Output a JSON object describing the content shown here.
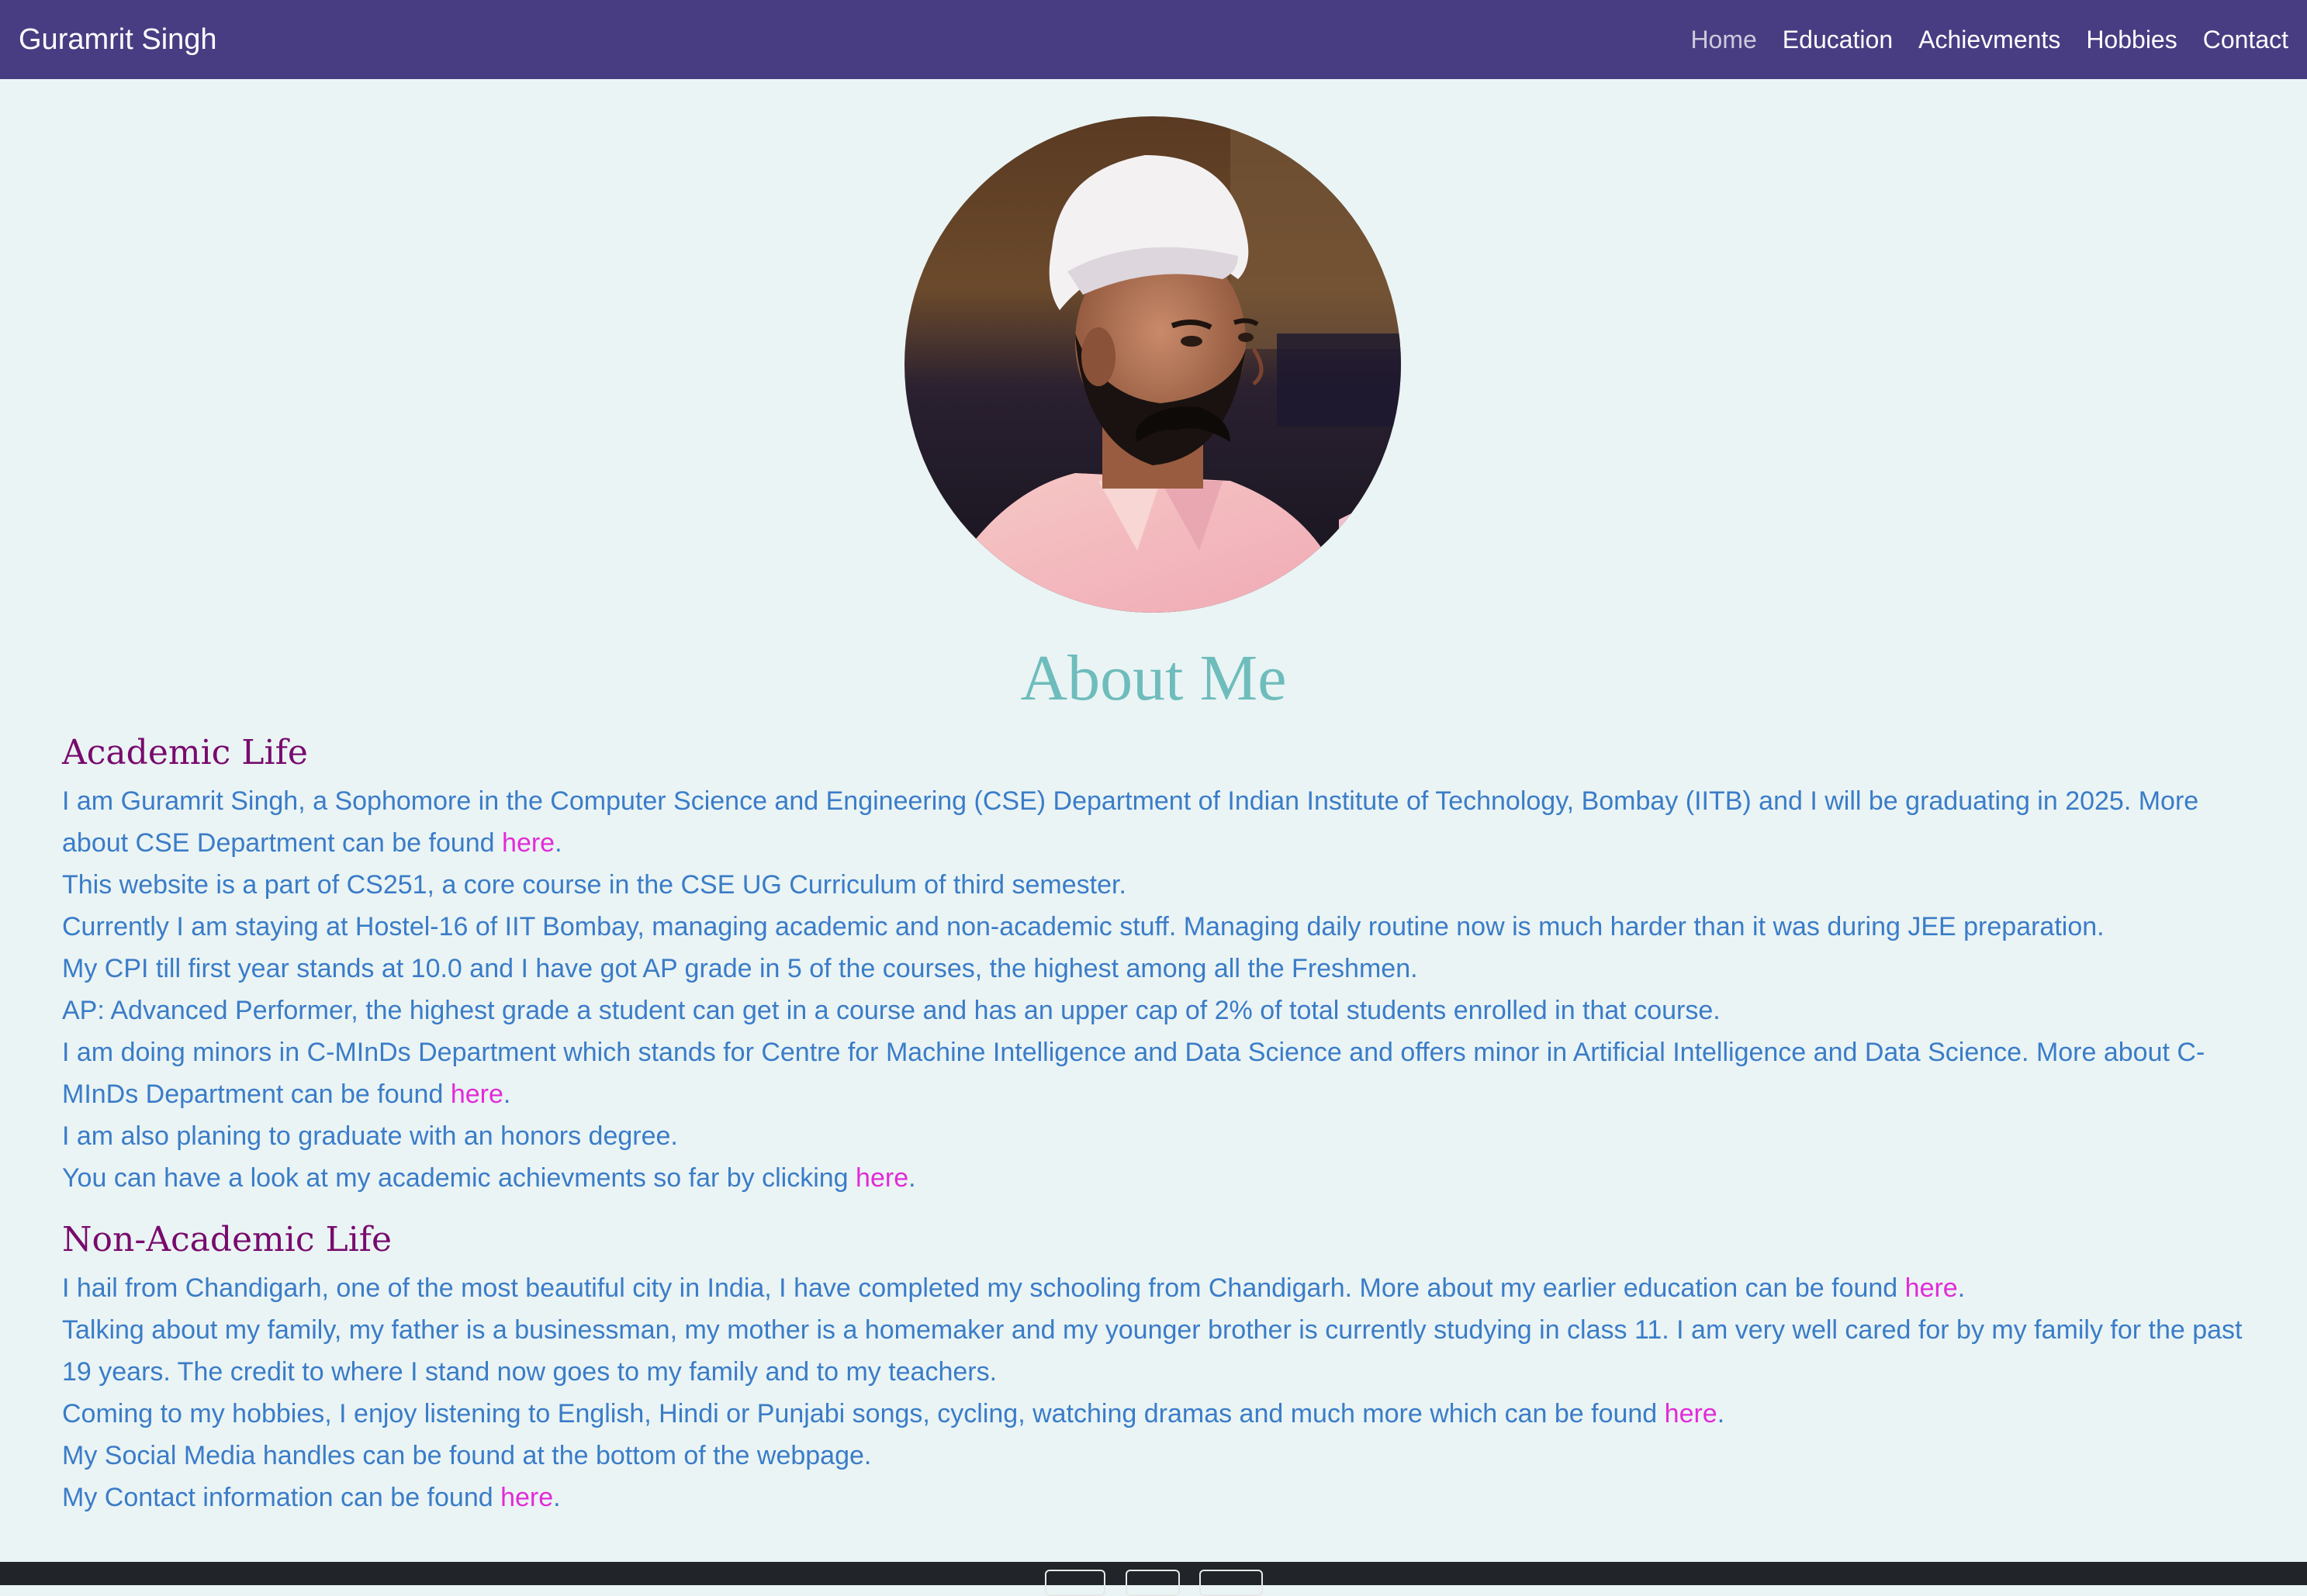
{
  "navbar": {
    "brand": "Guramrit Singh",
    "links": [
      "Home",
      "Education",
      "Achievments",
      "Hobbies",
      "Contact"
    ]
  },
  "about_title": "About Me",
  "academic": {
    "heading": "Academic Life",
    "p1_pre": "I am Guramrit Singh, a Sophomore in the Computer Science and Engineering (CSE) Department of Indian Institute of Technology, Bombay (IITB) and I will be graduating in 2025. More about CSE Department can be found ",
    "p1_link": "here",
    "p1_post": ".",
    "p2": "This website is a part of CS251, a core course in the CSE UG Curriculum of third semester.",
    "p3": "Currently I am staying at Hostel-16 of IIT Bombay, managing academic and non-academic stuff. Managing daily routine now is much harder than it was during JEE preparation.",
    "p4": "My CPI till first year stands at 10.0 and I have got AP grade in 5 of the courses, the highest among all the Freshmen.",
    "p5": "AP: Advanced Performer, the highest grade a student can get in a course and has an upper cap of 2% of total students enrolled in that course.",
    "p6_pre": "I am doing minors in C-MInDs Department which stands for Centre for Machine Intelligence and Data Science and offers minor in Artificial Intelligence and Data Science. More about C-MInDs Department can be found ",
    "p6_link": "here",
    "p6_post": ".",
    "p7": "I am also planing to graduate with an honors degree.",
    "p8_pre": "You can have a look at my academic achievments so far by clicking ",
    "p8_link": "here",
    "p8_post": "."
  },
  "non_academic": {
    "heading": "Non-Academic Life",
    "p1_pre": "I hail from Chandigarh, one of the most beautiful city in India, I have completed my schooling from Chandigarh. More about my earlier education can be found ",
    "p1_link": "here",
    "p1_post": ".",
    "p2": "Talking about my family, my father is a businessman, my mother is a homemaker and my younger brother is currently studying in class 11. I am very well cared for by my family for the past 19 years. The credit to where I stand now goes to my family and to my teachers.",
    "p3_pre": "Coming to my hobbies, I enjoy listening to English, Hindi or Punjabi songs, cycling, watching dramas and much more which can be found ",
    "p3_link": "here",
    "p3_post": ".",
    "p4": "My Social Media handles can be found at the bottom of the webpage.",
    "p5_pre": "My Contact information can be found ",
    "p5_link": "here",
    "p5_post": "."
  },
  "colors": {
    "navbar_bg": "#483d82",
    "page_bg": "#eaf4f4",
    "about_title": "#6fbcbc",
    "heading": "#780b6e",
    "body_text": "#3a7cc8",
    "link": "#e12bd8",
    "footer_bg": "#212529"
  },
  "footer": {
    "social_icons": [
      "social-icon-1",
      "social-icon-2",
      "social-icon-3"
    ]
  }
}
